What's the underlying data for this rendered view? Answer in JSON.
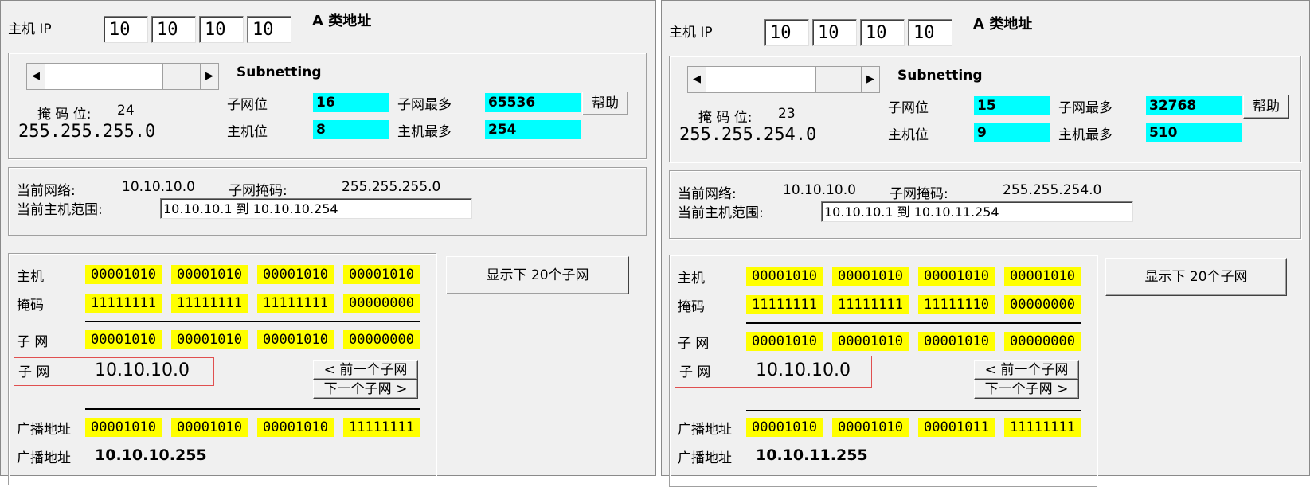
{
  "panels": [
    {
      "host_ip_label": "主机 IP",
      "ip_octets": [
        "10",
        "10",
        "10",
        "10"
      ],
      "class_label": "A 类地址",
      "subnetting_label": "Subnetting",
      "mask_bits_label": "掩 码 位:",
      "mask_bits": "24",
      "mask_dotted": "255.255.255.0",
      "subnet_bits_label": "子网位",
      "subnet_bits": "16",
      "max_subnets_label": "子网最多",
      "max_subnets": "65536",
      "help_button": "帮助",
      "host_bits_label": "主机位",
      "host_bits": "8",
      "max_hosts_label": "主机最多",
      "max_hosts": "254",
      "current_network_label": "当前网络:",
      "current_network": "10.10.10.0",
      "subnet_mask_label": "子网掩码:",
      "subnet_mask": "255.255.255.0",
      "host_range_label": "当前主机范围:",
      "host_range": "10.10.10.1  到  10.10.10.254",
      "binary": {
        "host_label": "主机",
        "host": [
          "00001010",
          "00001010",
          "00001010",
          "00001010"
        ],
        "mask_label": "掩码",
        "mask": [
          "11111111",
          "11111111",
          "11111111",
          "00000000"
        ],
        "subnet_label": "子 网",
        "subnet": [
          "00001010",
          "00001010",
          "00001010",
          "00000000"
        ],
        "subnet_dotted_label": "子 网",
        "subnet_dotted": "10.10.10.0",
        "broadcast_label": "广播地址",
        "broadcast": [
          "00001010",
          "00001010",
          "00001010",
          "11111111"
        ],
        "broadcast_dotted_label": "广播地址",
        "broadcast_dotted": "10.10.10.255"
      },
      "prev_subnet_button": "< 前一个子网",
      "next_subnet_button": "下一个子网 >",
      "show_next_button": "显示下 20个子网"
    },
    {
      "host_ip_label": "主机 IP",
      "ip_octets": [
        "10",
        "10",
        "10",
        "10"
      ],
      "class_label": "A 类地址",
      "subnetting_label": "Subnetting",
      "mask_bits_label": "掩 码 位:",
      "mask_bits": "23",
      "mask_dotted": "255.255.254.0",
      "subnet_bits_label": "子网位",
      "subnet_bits": "15",
      "max_subnets_label": "子网最多",
      "max_subnets": "32768",
      "help_button": "帮助",
      "host_bits_label": "主机位",
      "host_bits": "9",
      "max_hosts_label": "主机最多",
      "max_hosts": "510",
      "current_network_label": "当前网络:",
      "current_network": "10.10.10.0",
      "subnet_mask_label": "子网掩码:",
      "subnet_mask": "255.255.254.0",
      "host_range_label": "当前主机范围:",
      "host_range": "10.10.10.1  到  10.10.11.254",
      "binary": {
        "host_label": "主机",
        "host": [
          "00001010",
          "00001010",
          "00001010",
          "00001010"
        ],
        "mask_label": "掩码",
        "mask": [
          "11111111",
          "11111111",
          "11111110",
          "00000000"
        ],
        "subnet_label": "子 网",
        "subnet": [
          "00001010",
          "00001010",
          "00001010",
          "00000000"
        ],
        "subnet_dotted_label": "子 网",
        "subnet_dotted": "10.10.10.0",
        "broadcast_label": "广播地址",
        "broadcast": [
          "00001010",
          "00001010",
          "00001011",
          "11111111"
        ],
        "broadcast_dotted_label": "广播地址",
        "broadcast_dotted": "10.10.11.255"
      },
      "prev_subnet_button": "< 前一个子网",
      "next_subnet_button": "下一个子网 >",
      "show_next_button": "显示下 20个子网"
    }
  ],
  "colors": {
    "highlight_cyan": "#00ffff",
    "binary_yellow": "#ffff00",
    "subnet_box_red": "#e05050"
  }
}
